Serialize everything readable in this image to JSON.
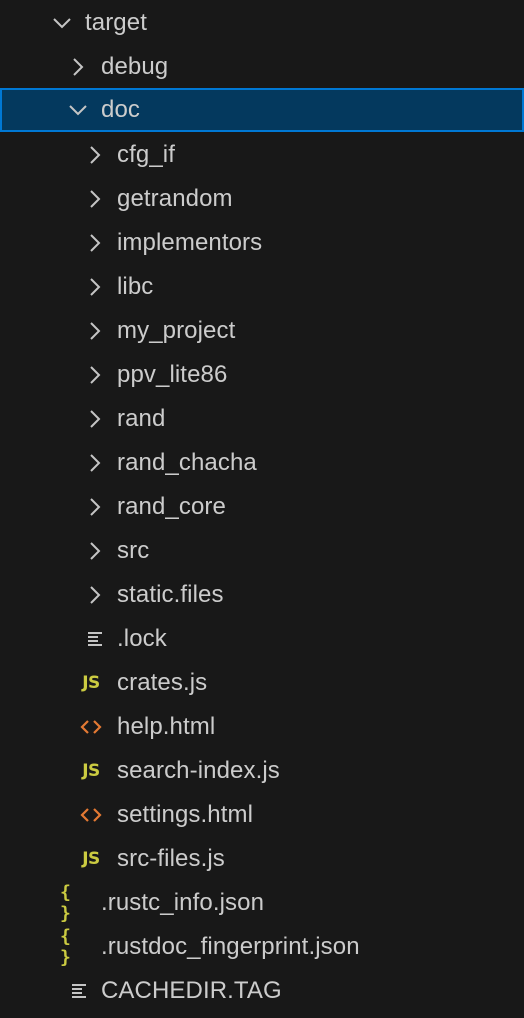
{
  "explorer": {
    "items": [
      {
        "label": "target",
        "kind": "folder",
        "state": "expanded",
        "icon": "chevron-down-icon"
      },
      {
        "label": "debug",
        "kind": "folder",
        "state": "collapsed",
        "icon": "chevron-right-icon"
      },
      {
        "label": "doc",
        "kind": "folder",
        "state": "expanded",
        "selected": true,
        "icon": "chevron-down-icon"
      },
      {
        "label": "cfg_if",
        "kind": "folder",
        "state": "collapsed",
        "icon": "chevron-right-icon"
      },
      {
        "label": "getrandom",
        "kind": "folder",
        "state": "collapsed",
        "icon": "chevron-right-icon"
      },
      {
        "label": "implementors",
        "kind": "folder",
        "state": "collapsed",
        "icon": "chevron-right-icon"
      },
      {
        "label": "libc",
        "kind": "folder",
        "state": "collapsed",
        "icon": "chevron-right-icon"
      },
      {
        "label": "my_project",
        "kind": "folder",
        "state": "collapsed",
        "icon": "chevron-right-icon"
      },
      {
        "label": "ppv_lite86",
        "kind": "folder",
        "state": "collapsed",
        "icon": "chevron-right-icon"
      },
      {
        "label": "rand",
        "kind": "folder",
        "state": "collapsed",
        "icon": "chevron-right-icon"
      },
      {
        "label": "rand_chacha",
        "kind": "folder",
        "state": "collapsed",
        "icon": "chevron-right-icon"
      },
      {
        "label": "rand_core",
        "kind": "folder",
        "state": "collapsed",
        "icon": "chevron-right-icon"
      },
      {
        "label": "src",
        "kind": "folder",
        "state": "collapsed",
        "icon": "chevron-right-icon"
      },
      {
        "label": "static.files",
        "kind": "folder",
        "state": "collapsed",
        "icon": "chevron-right-icon"
      },
      {
        "label": ".lock",
        "kind": "file",
        "icon": "text-file-icon"
      },
      {
        "label": "crates.js",
        "kind": "file",
        "icon": "js-file-icon",
        "glyph": "JS"
      },
      {
        "label": "help.html",
        "kind": "file",
        "icon": "html-file-icon"
      },
      {
        "label": "search-index.js",
        "kind": "file",
        "icon": "js-file-icon",
        "glyph": "JS"
      },
      {
        "label": "settings.html",
        "kind": "file",
        "icon": "html-file-icon"
      },
      {
        "label": "src-files.js",
        "kind": "file",
        "icon": "js-file-icon",
        "glyph": "JS"
      },
      {
        "label": ".rustc_info.json",
        "kind": "file",
        "icon": "json-file-icon",
        "glyph": "{ }"
      },
      {
        "label": ".rustdoc_fingerprint.json",
        "kind": "file",
        "icon": "json-file-icon",
        "glyph": "{ }"
      },
      {
        "label": "CACHEDIR.TAG",
        "kind": "file",
        "icon": "text-file-icon"
      }
    ]
  },
  "colors": {
    "background": "#181818",
    "text": "#cccccc",
    "selection_bg": "#04395e",
    "selection_border": "#0078d4",
    "js_icon": "#cbcb41",
    "json_icon": "#cbcb41",
    "html_icon": "#e37933",
    "chevron": "#c5c5c5"
  }
}
